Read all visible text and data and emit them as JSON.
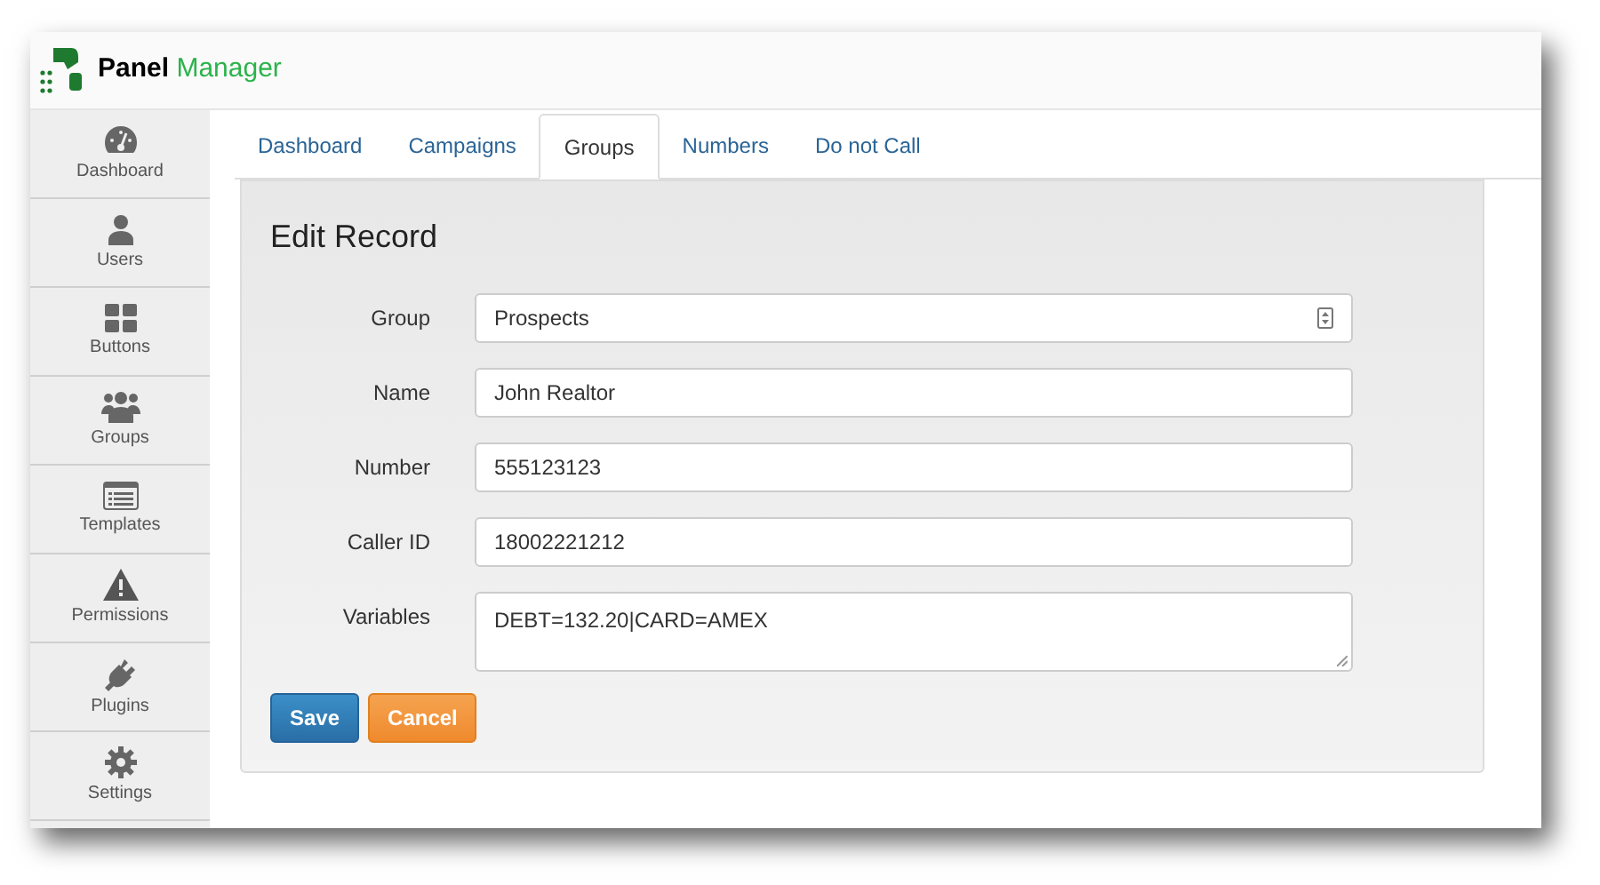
{
  "app": {
    "logo_word_1": "Panel",
    "logo_word_2": "Manager"
  },
  "sidebar": {
    "items": [
      {
        "label": "Dashboard",
        "kind": "gauge",
        "selected": false
      },
      {
        "label": "Users",
        "kind": "user",
        "selected": false
      },
      {
        "label": "Buttons",
        "kind": "grid",
        "selected": false
      },
      {
        "label": "Groups",
        "kind": "group",
        "selected": false
      },
      {
        "label": "Templates",
        "kind": "list",
        "selected": false
      },
      {
        "label": "Permissions",
        "kind": "warning",
        "selected": false
      },
      {
        "label": "Plugins",
        "kind": "plug",
        "selected": false
      },
      {
        "label": "Settings",
        "kind": "gear",
        "selected": false
      }
    ]
  },
  "tabs": [
    {
      "label": "Dashboard",
      "selected": false
    },
    {
      "label": "Campaigns",
      "selected": false
    },
    {
      "label": "Groups",
      "selected": true
    },
    {
      "label": "Numbers",
      "selected": false
    },
    {
      "label": "Do not Call",
      "selected": false
    }
  ],
  "form": {
    "title": "Edit Record",
    "fields": [
      {
        "label": "Group",
        "kind": "select",
        "value": "Prospects"
      },
      {
        "label": "Name",
        "kind": "text",
        "value": "John Realtor"
      },
      {
        "label": "Number",
        "kind": "text",
        "value": "555123123"
      },
      {
        "label": "Caller ID",
        "kind": "text",
        "value": "18002221212"
      },
      {
        "label": "Variables",
        "kind": "textarea",
        "value": "DEBT=132.20|CARD=AMEX"
      }
    ],
    "buttons": [
      {
        "label": "Save",
        "kind": "primary"
      },
      {
        "label": "Cancel",
        "kind": "warning"
      }
    ]
  }
}
